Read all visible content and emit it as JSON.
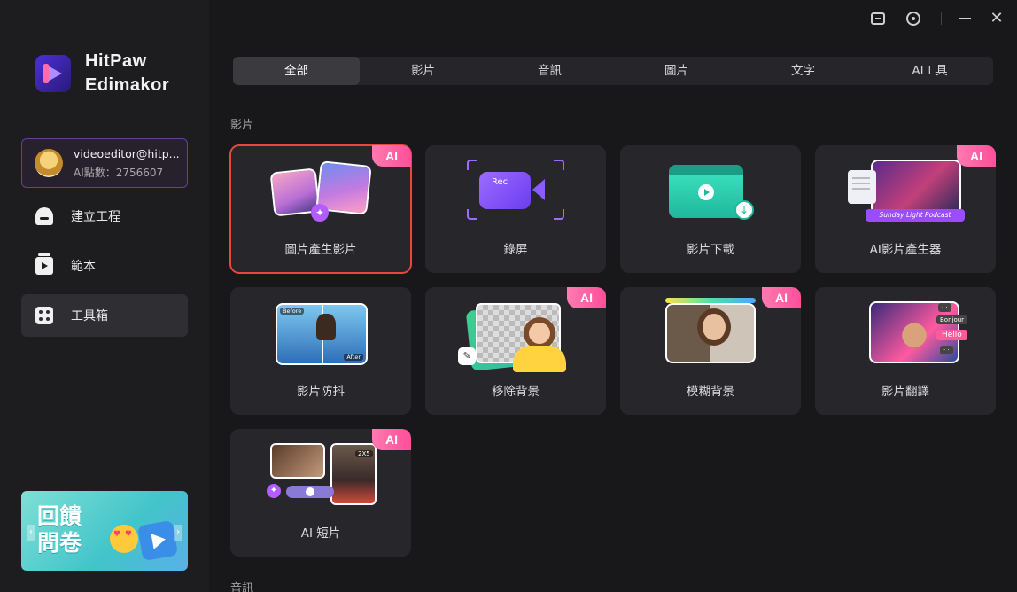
{
  "app": {
    "brand_line1": "HitPaw",
    "brand_line2": "Edimakor"
  },
  "account": {
    "email": "videoeditor@hitp...",
    "points": "AI點數：2756607"
  },
  "sidebar": {
    "items": [
      {
        "label": "建立工程",
        "icon": "home-icon"
      },
      {
        "label": "範本",
        "icon": "template-icon"
      },
      {
        "label": "工具箱",
        "icon": "toolbox-icon",
        "active": true
      }
    ],
    "survey": {
      "line1": "回饋",
      "line2": "問卷"
    }
  },
  "titlebar": {
    "icons": [
      "feedback-icon",
      "settings-icon",
      "minimize-icon",
      "close-icon"
    ]
  },
  "tabs": [
    {
      "label": "全部",
      "active": true
    },
    {
      "label": "影片"
    },
    {
      "label": "音訊"
    },
    {
      "label": "圖片"
    },
    {
      "label": "文字"
    },
    {
      "label": "AI工具"
    }
  ],
  "sections": {
    "video": "影片",
    "audio": "音訊"
  },
  "tools": [
    {
      "label": "圖片產生影片",
      "ai": true,
      "selected": true
    },
    {
      "label": "錄屏",
      "ai": false,
      "art_text": "Rec"
    },
    {
      "label": "影片下載",
      "ai": false
    },
    {
      "label": "AI影片產生器",
      "ai": true,
      "art_text": "Sunday Light Podcast"
    },
    {
      "label": "影片防抖",
      "ai": false,
      "art_before": "Before",
      "art_after": "After"
    },
    {
      "label": "移除背景",
      "ai": true
    },
    {
      "label": "模糊背景",
      "ai": true
    },
    {
      "label": "影片翻譯",
      "ai": true,
      "art_chips": [
        "Bonjour",
        "Hello"
      ]
    },
    {
      "label": "AI 短片",
      "ai": true,
      "art_text": "2X5"
    }
  ],
  "ai_badge": "AI",
  "colors": {
    "accent": "#ff4f9a",
    "selected_border": "#e5483f",
    "background": "#18181b",
    "card": "#27272b"
  }
}
